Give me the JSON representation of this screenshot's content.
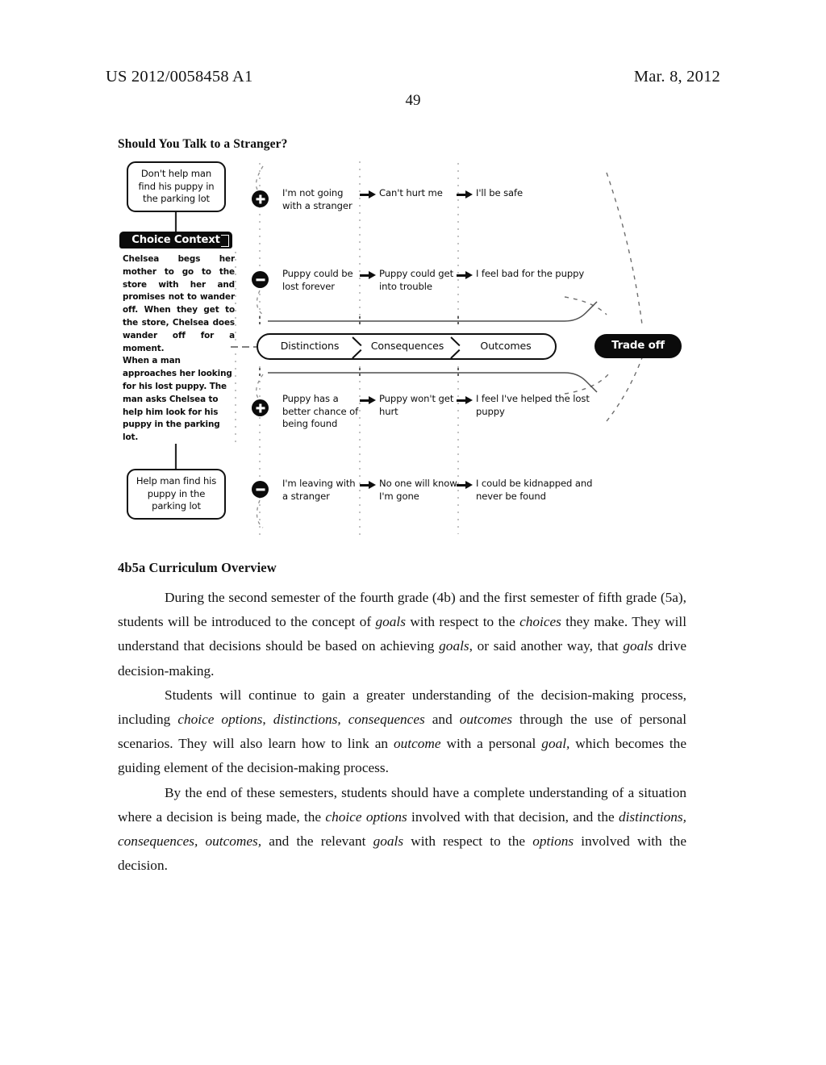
{
  "header": {
    "publication_number": "US 2012/0058458 A1",
    "publication_date": "Mar. 8, 2012",
    "page_number": "49"
  },
  "figure": {
    "title": "Should You Talk to a Stranger?",
    "choice_options": {
      "top": "Don't help man find his puppy in the parking lot",
      "bottom": "Help man find his puppy in the parking lot"
    },
    "context": {
      "band_label": "Choice Context",
      "paragraph_1": "Chelsea begs her mother to go to the store with her and promises not to wander off. When they get to the store, Chelsea does wander off for a moment.",
      "paragraph_2": "When a man approaches her looking for his lost puppy. The man asks Chelsea to help him look for his puppy in the parking lot."
    },
    "stage_bar": {
      "distinctions": "Distinctions",
      "consequences": "Consequences",
      "outcomes": "Outcomes"
    },
    "tradeoff_label": "Trade off",
    "rows": [
      {
        "polarity": "plus",
        "distinction": "I'm not going with a stranger",
        "consequence": "Can't hurt me",
        "outcome": "I'll be safe"
      },
      {
        "polarity": "minus",
        "distinction": "Puppy could be lost forever",
        "consequence": "Puppy could get into trouble",
        "outcome": "I feel bad for the puppy"
      },
      {
        "polarity": "plus",
        "distinction": "Puppy has a better chance of being found",
        "consequence": "Puppy won't get hurt",
        "outcome": "I feel I've helped the lost puppy"
      },
      {
        "polarity": "minus",
        "distinction": "I'm leaving with a stranger",
        "consequence": "No one will know I'm gone",
        "outcome": "I could be kidnapped and never be found"
      }
    ]
  },
  "section": {
    "heading": "4b5a Curriculum Overview"
  },
  "colors": {
    "ink": "#141414",
    "badge_fill": "#0b0b0b",
    "badge_text": "#ffffff",
    "paper": "#ffffff"
  }
}
